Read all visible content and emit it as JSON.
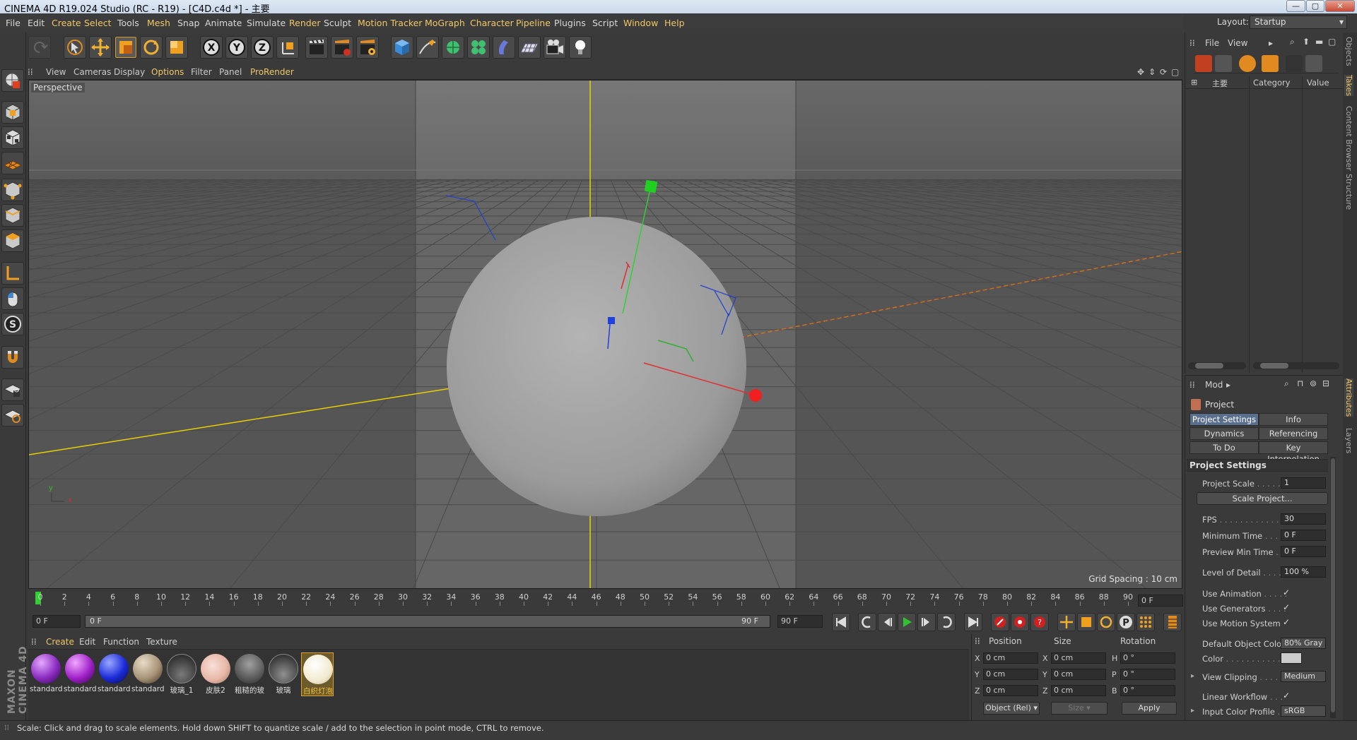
{
  "window": {
    "title": "CINEMA 4D R19.024 Studio (RC - R19) - [C4D.c4d *] - 主要",
    "minimize": "—",
    "maximize": "▢",
    "close": "✕"
  },
  "menubar": {
    "items": [
      "File",
      "Edit",
      "Create",
      "Select",
      "Tools",
      "Mesh",
      "Snap",
      "Animate",
      "Simulate",
      "Render",
      "Sculpt",
      "Motion Tracker",
      "MoGraph",
      "Character",
      "Pipeline",
      "Plugins",
      "Script",
      "Window",
      "Help"
    ],
    "layout_label": "Layout:",
    "layout_value": "Startup"
  },
  "toolbar": {
    "axis_x": "X",
    "axis_y": "Y",
    "axis_z": "Z"
  },
  "viewport": {
    "menu": [
      "View",
      "Cameras",
      "Display",
      "Options",
      "Filter",
      "Panel",
      "ProRender"
    ],
    "camera_label": "Perspective",
    "grid_spacing": "Grid Spacing : 10 cm",
    "axis_y": "y",
    "axis_x": "x"
  },
  "timeline": {
    "ticks": [
      "0",
      "2",
      "4",
      "6",
      "8",
      "10",
      "12",
      "14",
      "16",
      "18",
      "20",
      "22",
      "24",
      "26",
      "28",
      "30",
      "32",
      "34",
      "36",
      "38",
      "40",
      "42",
      "44",
      "46",
      "48",
      "50",
      "52",
      "54",
      "56",
      "58",
      "60",
      "62",
      "64",
      "66",
      "68",
      "70",
      "72",
      "74",
      "76",
      "78",
      "80",
      "82",
      "84",
      "86",
      "88",
      "90"
    ],
    "current_frame": "0 F",
    "start_field": "0 F",
    "range_start": "0 F",
    "range_end": "90 F",
    "end_field": "90 F"
  },
  "materials": {
    "menu": [
      "Create",
      "Edit",
      "Function",
      "Texture"
    ],
    "items": [
      {
        "label": "standard",
        "color": "#8a2bc0"
      },
      {
        "label": "standard",
        "color": "#a020c8"
      },
      {
        "label": "standard",
        "color": "#1a2ad8"
      },
      {
        "label": "standard",
        "color": "#a89478"
      },
      {
        "label": "玻璃_1",
        "color": "#505050"
      },
      {
        "label": "皮肤2",
        "color": "#e8b8a8"
      },
      {
        "label": "粗糙的玻",
        "color": "#6a6a6a"
      },
      {
        "label": "玻璃",
        "color": "#5a5a5a"
      },
      {
        "label": "白织灯泡",
        "color": "#f2ead0"
      }
    ]
  },
  "coordinates": {
    "headers": [
      "Position",
      "Size",
      "Rotation"
    ],
    "rows": [
      {
        "pos_axis": "X",
        "pos": "0 cm",
        "size_axis": "X",
        "size": "0 cm",
        "rot_axis": "H",
        "rot": "0 °"
      },
      {
        "pos_axis": "Y",
        "pos": "0 cm",
        "size_axis": "Y",
        "size": "0 cm",
        "rot_axis": "P",
        "rot": "0 °"
      },
      {
        "pos_axis": "Z",
        "pos": "0 cm",
        "size_axis": "Z",
        "size": "0 cm",
        "rot_axis": "B",
        "rot": "0 °"
      }
    ],
    "mode": "Object (Rel)",
    "size_mode": "Size",
    "apply": "Apply"
  },
  "objects_panel": {
    "menu": [
      "File",
      "View"
    ],
    "col_name": "主要",
    "col_category": "Category",
    "col_value": "Value"
  },
  "attributes": {
    "menu": "Mod",
    "title": "Project",
    "tabs": [
      "Project Settings",
      "Info",
      "Dynamics",
      "Referencing",
      "To Do",
      "Key Interpolation"
    ],
    "section": "Project Settings",
    "project_scale_label": "Project Scale",
    "project_scale": "1",
    "scale_project_btn": "Scale Project...",
    "fps_label": "FPS",
    "fps": "30",
    "min_time_label": "Minimum Time",
    "min_time": "0 F",
    "preview_min_label": "Preview Min Time",
    "preview_min": "0 F",
    "lod_label": "Level of Detail",
    "lod": "100 %",
    "use_animation_label": "Use Animation",
    "use_generators_label": "Use Generators",
    "use_motion_label": "Use Motion System",
    "check": "✓",
    "default_color_label": "Default Object Color",
    "default_color": "80% Gray",
    "color_label": "Color",
    "view_clipping_label": "View Clipping",
    "view_clipping": "Medium",
    "linear_workflow_label": "Linear Workflow",
    "input_profile_label": "Input Color Profile",
    "input_profile": "sRGB"
  },
  "right_tabs": [
    "Objects",
    "Takes",
    "Content Browser",
    "Structure",
    "Attributes",
    "Layers"
  ],
  "branding": "MAXON CINEMA 4D",
  "status": "Scale: Click and drag to scale elements. Hold down SHIFT to quantize scale / add to the selection in point mode, CTRL to remove."
}
